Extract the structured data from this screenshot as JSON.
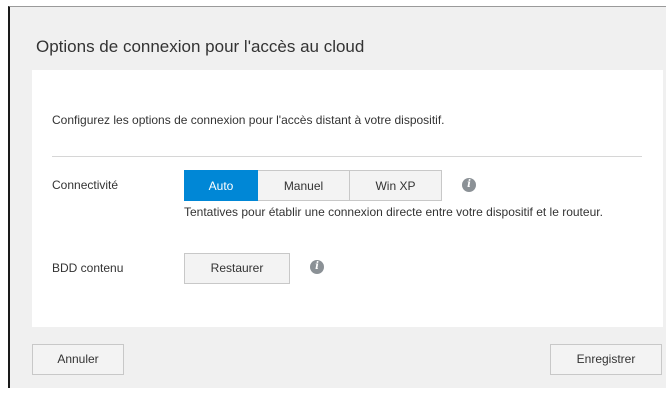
{
  "dialog": {
    "title": "Options de connexion pour l'accès au cloud",
    "description": "Configurez les options de connexion pour l'accès distant à votre dispositif.",
    "connectivity": {
      "label": "Connectivité",
      "options": [
        "Auto",
        "Manuel",
        "Win XP"
      ],
      "selected": "Auto",
      "help": "Tentatives pour établir une connexion directe entre votre dispositif et le routeur."
    },
    "database": {
      "label": "BDD contenu",
      "restore_label": "Restaurer"
    },
    "footer": {
      "cancel_label": "Annuler",
      "save_label": "Enregistrer"
    },
    "icons": {
      "info": "info-icon",
      "info_glyph": "i"
    },
    "colors": {
      "accent": "#0087d6",
      "background": "#f0f0f0",
      "panel": "#ffffff"
    }
  }
}
